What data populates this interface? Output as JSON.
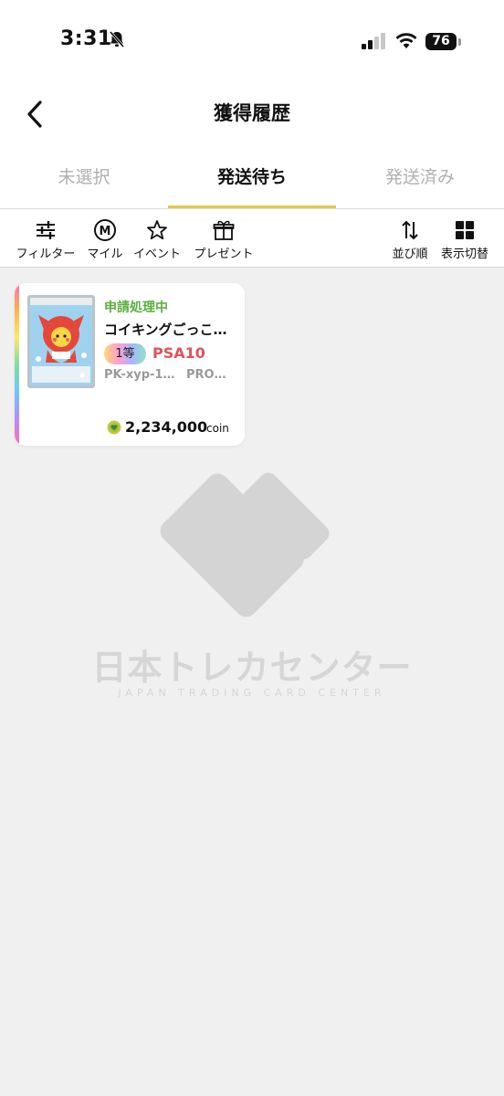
{
  "status_bar": {
    "time": "3:31",
    "battery": "76"
  },
  "header": {
    "title": "獲得履歴"
  },
  "tabs": [
    {
      "label": "未選択"
    },
    {
      "label": "発送待ち"
    },
    {
      "label": "発送済み"
    }
  ],
  "toolbar": {
    "filter": "フィルター",
    "mile": "マイル",
    "event": "イベント",
    "present": "プレゼント",
    "sort": "並び順",
    "view": "表示切替"
  },
  "card": {
    "status": "申請処理中",
    "name": "コイキングごっこ…",
    "rank": "1等",
    "grade": "PSA10",
    "code": "PK-xyp-1…",
    "code2": "PRO…",
    "price": "2,234,000",
    "unit": "coin"
  },
  "watermark": {
    "title": "日本トレカセンター",
    "subtitle": "JAPAN TRADING CARD CENTER"
  },
  "colors": {
    "accent": "#e5c84a",
    "status": "#5aae3f",
    "grade": "#e0525a"
  }
}
